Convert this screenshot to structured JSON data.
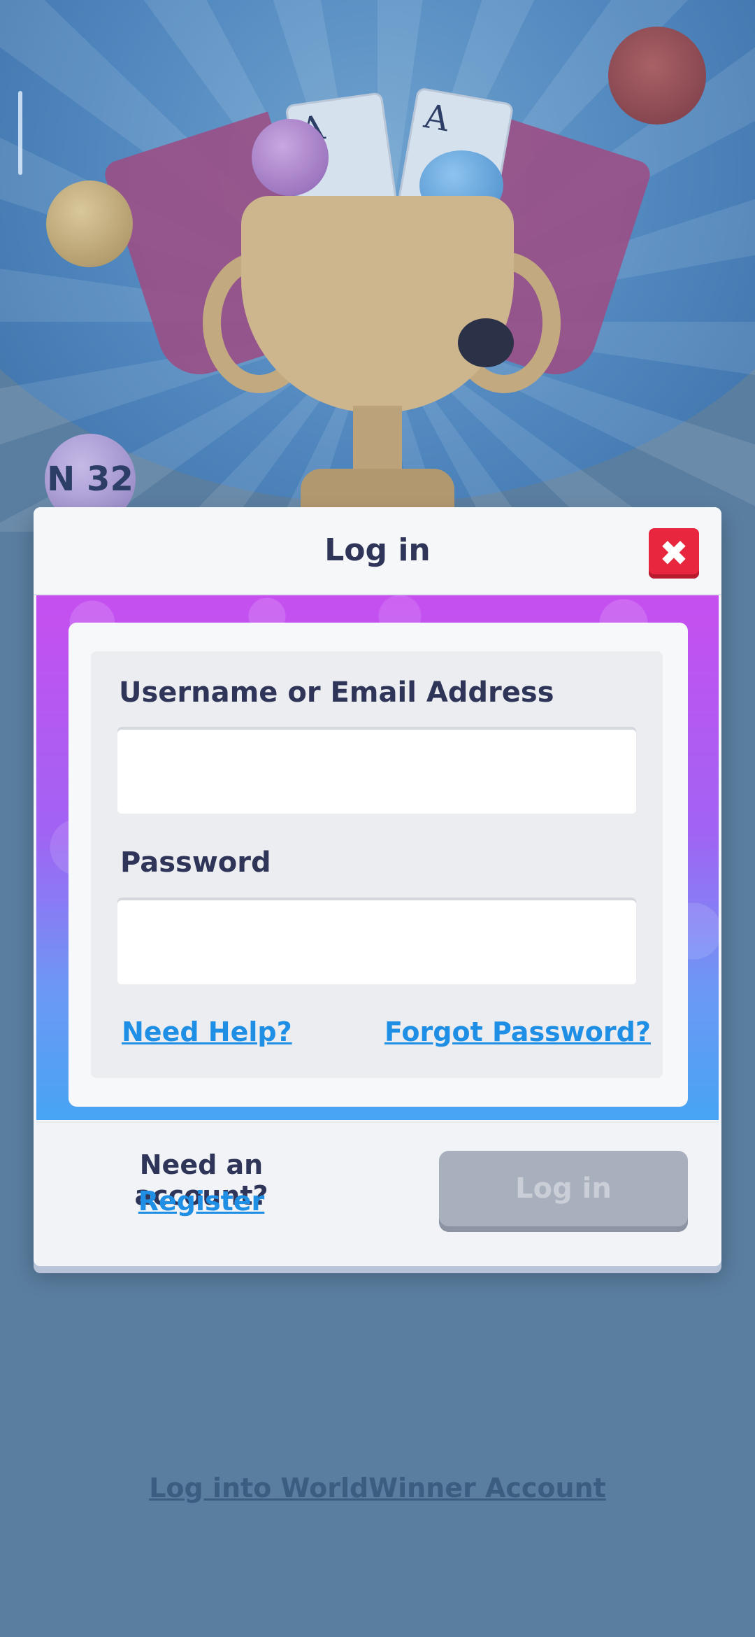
{
  "modal": {
    "title": "Log in",
    "close_icon": "close-icon",
    "form": {
      "username_label": "Username or Email Address",
      "username_value": "",
      "password_label": "Password",
      "password_value": "",
      "need_help": "Need Help?",
      "forgot_password": "Forgot Password?"
    },
    "footer": {
      "need_account": "Need an account?",
      "register": "Register",
      "login_button": "Log in"
    }
  },
  "background": {
    "bingo_ball_text": "N 32",
    "card_1": "A",
    "card_2": "A"
  },
  "worldwinner_link": "Log into WorldWinner Account",
  "colors": {
    "close_button": "#e8263e",
    "link": "#1f8fe5",
    "band_top": "#c64ff0",
    "band_bottom": "#47a4f4",
    "login_button_disabled": "#a9b0bd"
  }
}
